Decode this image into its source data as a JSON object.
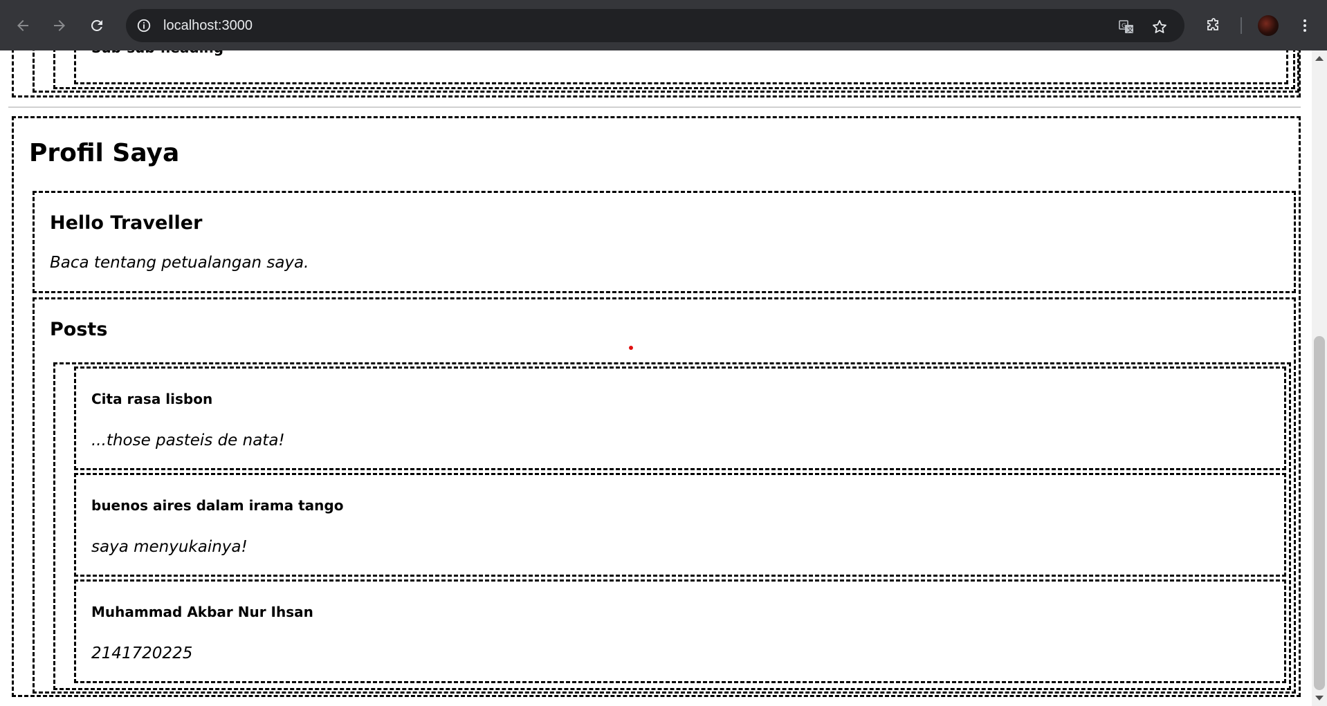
{
  "browser": {
    "url": "localhost:3000",
    "icons": {
      "back": "arrow-left-icon",
      "forward": "arrow-right-icon",
      "reload": "reload-icon",
      "site_info": "info-icon",
      "translate": "translate-icon",
      "bookmark": "star-icon",
      "extensions": "puzzle-icon",
      "profile": "avatar",
      "menu": "kebab-menu-icon"
    }
  },
  "page": {
    "top_section": {
      "sub_sub_heading": "Sub-sub-heading"
    },
    "profile": {
      "title": "Profil Saya",
      "intro": {
        "heading": "Hello Traveller",
        "text": "Baca tentang petualangan saya."
      },
      "posts": {
        "heading": "Posts",
        "items": [
          {
            "title": "Cita rasa lisbon",
            "text": "...those pasteis de nata!"
          },
          {
            "title": "buenos aires dalam irama tango",
            "text": "saya menyukainya!"
          },
          {
            "title": "Muhammad Akbar Nur Ihsan",
            "text": "2141720225"
          }
        ]
      }
    }
  },
  "colors": {
    "chrome_bg": "#35363a",
    "omnibox_bg": "#202124",
    "border": "#000000",
    "cursor_dot": "#e01010"
  }
}
